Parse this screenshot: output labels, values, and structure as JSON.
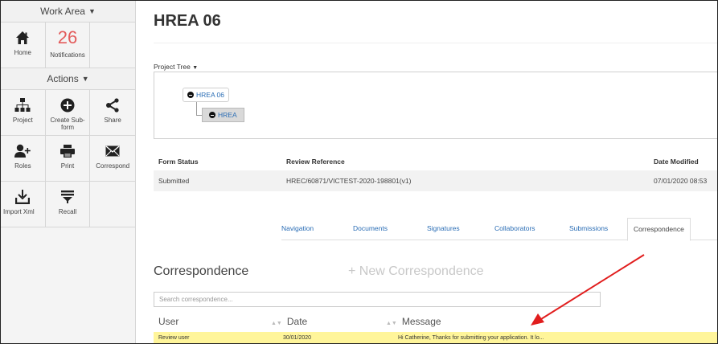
{
  "sidebar": {
    "work_area_label": "Work Area",
    "actions_label": "Actions",
    "tiles": {
      "home": "Home",
      "notifications_count": "26",
      "notifications": "Notifications",
      "project": "Project",
      "create_sub_form": "Create Sub-form",
      "share": "Share",
      "roles": "Roles",
      "print": "Print",
      "correspond": "Correspond",
      "import_xml": "Import Xml",
      "recall": "Recall"
    }
  },
  "page": {
    "title": "HREA 06",
    "project_tree_label": "Project Tree",
    "tree": {
      "root": "HREA 06",
      "child": "HREA"
    }
  },
  "status": {
    "headers": {
      "form_status": "Form Status",
      "review_reference": "Review Reference",
      "date_modified": "Date Modified"
    },
    "row": {
      "form_status": "Submitted",
      "review_reference": "HREC/60871/VICTEST-2020-198801(v1)",
      "date_modified": "07/01/2020 08:53"
    }
  },
  "tabs": [
    "Navigation",
    "Documents",
    "Signatures",
    "Collaborators",
    "Submissions",
    "Correspondence"
  ],
  "correspondence": {
    "title": "Correspondence",
    "new_button": "+ New Correspondence",
    "search_placeholder": "Search correspondence...",
    "columns": {
      "user": "User",
      "date": "Date",
      "message": "Message"
    },
    "rows": [
      {
        "user": "Review user",
        "date": "30/01/2020",
        "message": "Hi Catherine, Thanks for submitting your application. It lo..."
      }
    ]
  },
  "colors": {
    "link": "#2a6db5",
    "notification": "#e35b5b",
    "highlight_row": "#fff59a",
    "annotation_arrow": "#e11d1d"
  },
  "icons": [
    "chevron-down-icon",
    "home-icon",
    "project-tree-icon",
    "add-circle-icon",
    "share-icon",
    "add-user-icon",
    "printer-icon",
    "envelope-icon",
    "import-icon",
    "recall-icon",
    "sort-icon",
    "minus-circle-icon"
  ]
}
